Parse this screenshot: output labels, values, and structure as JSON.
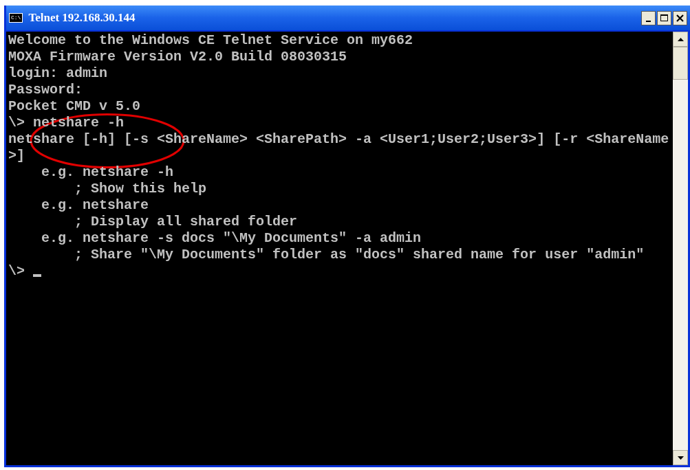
{
  "window": {
    "title": "Telnet 192.168.30.144",
    "app_icon_text": "C:\\"
  },
  "console": {
    "lines": [
      "Welcome to the Windows CE Telnet Service on my662",
      "MOXA Firmware Version V2.0 Build 08030315",
      "login: admin",
      "Password:",
      "Pocket CMD v 5.0",
      "\\> netshare -h",
      "netshare [-h] [-s <ShareName> <SharePath> -a <User1;User2;User3>] [-r <ShareName",
      ">]",
      "    e.g. netshare -h",
      "        ; Show this help",
      "    e.g. netshare",
      "        ; Display all shared folder",
      "    e.g. netshare -s docs \"\\My Documents\" -a admin",
      "        ; Share \"\\My Documents\" folder as \"docs\" shared name for user \"admin\""
    ],
    "prompt": "\\>",
    "cursor": true
  }
}
